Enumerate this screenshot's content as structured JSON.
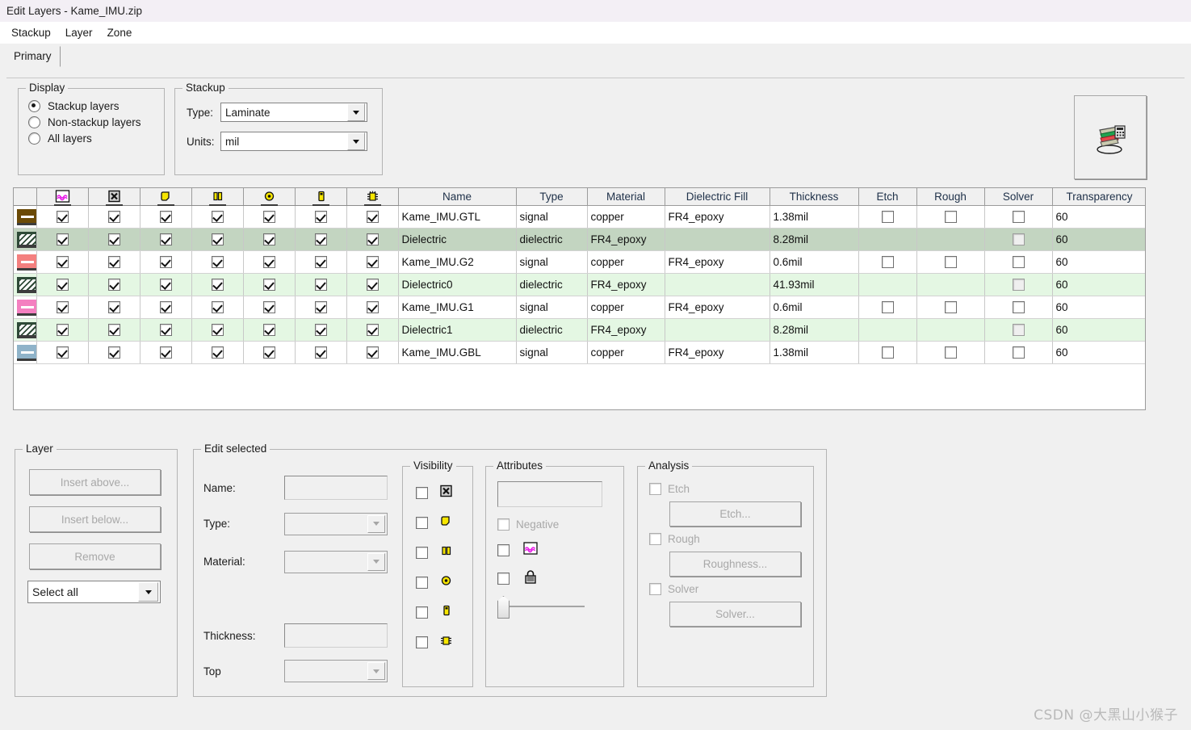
{
  "window": {
    "title": "Edit Layers - Kame_IMU.zip"
  },
  "menubar": {
    "items": [
      "Stackup",
      "Layer",
      "Zone"
    ]
  },
  "tabs": [
    {
      "label": "Primary",
      "active": true
    }
  ],
  "display": {
    "legend": "Display",
    "options": [
      {
        "label": "Stackup layers",
        "selected": true
      },
      {
        "label": "Non-stackup layers",
        "selected": false
      },
      {
        "label": "All layers",
        "selected": false
      }
    ]
  },
  "stackup_panel": {
    "legend": "Stackup",
    "type_label": "Type:",
    "type_value": "Laminate",
    "units_label": "Units:",
    "units_value": "mil"
  },
  "preview_button": {
    "icon": "stackup-3d-view-icon"
  },
  "table": {
    "icon_columns": [
      {
        "icon": "dielectric-hatch-icon"
      },
      {
        "icon": "negative-x-icon"
      },
      {
        "icon": "pad-blob-icon"
      },
      {
        "icon": "traces-bars-icon"
      },
      {
        "icon": "via-ring-icon"
      },
      {
        "icon": "drill-pin-icon"
      },
      {
        "icon": "component-icon"
      }
    ],
    "text_columns": [
      "Name",
      "Type",
      "Material",
      "Dielectric Fill",
      "Thickness",
      "Etch",
      "Rough",
      "Solver",
      "Transparency"
    ],
    "rows": [
      {
        "color": "#6b4a06",
        "kind": "signal",
        "selected": false,
        "name": "Kame_IMU.GTL",
        "type": "signal",
        "material": "copper",
        "fill": "FR4_epoxy",
        "thickness": "1.38mil",
        "etch": false,
        "rough": false,
        "solver": false,
        "transparency": "60",
        "checks": [
          true,
          true,
          true,
          true,
          true,
          true,
          true
        ]
      },
      {
        "color": "#2e4a37",
        "kind": "dielectric",
        "selected": true,
        "name": "Dielectric",
        "type": "dielectric",
        "material": "FR4_epoxy",
        "fill": "",
        "thickness": "8.28mil",
        "etch": null,
        "rough": null,
        "solver": false,
        "transparency": "60",
        "checks": [
          true,
          true,
          true,
          true,
          true,
          true,
          true
        ]
      },
      {
        "color": "#f4807f",
        "kind": "signal",
        "selected": false,
        "name": "Kame_IMU.G2",
        "type": "signal",
        "material": "copper",
        "fill": "FR4_epoxy",
        "thickness": "0.6mil",
        "etch": false,
        "rough": false,
        "solver": false,
        "transparency": "60",
        "checks": [
          true,
          true,
          true,
          true,
          true,
          true,
          true
        ]
      },
      {
        "color": "#2e4a37",
        "kind": "dielectric",
        "selected": false,
        "name": "Dielectric0",
        "type": "dielectric",
        "material": "FR4_epoxy",
        "fill": "",
        "thickness": "41.93mil",
        "etch": null,
        "rough": null,
        "solver": false,
        "transparency": "60",
        "checks": [
          true,
          true,
          true,
          true,
          true,
          true,
          true
        ]
      },
      {
        "color": "#f47fc0",
        "kind": "signal",
        "selected": false,
        "name": "Kame_IMU.G1",
        "type": "signal",
        "material": "copper",
        "fill": "FR4_epoxy",
        "thickness": "0.6mil",
        "etch": false,
        "rough": false,
        "solver": false,
        "transparency": "60",
        "checks": [
          true,
          true,
          true,
          true,
          true,
          true,
          true
        ]
      },
      {
        "color": "#2e4a37",
        "kind": "dielectric",
        "selected": false,
        "name": "Dielectric1",
        "type": "dielectric",
        "material": "FR4_epoxy",
        "fill": "",
        "thickness": "8.28mil",
        "etch": null,
        "rough": null,
        "solver": false,
        "transparency": "60",
        "checks": [
          true,
          true,
          true,
          true,
          true,
          true,
          true
        ]
      },
      {
        "color": "#8fb3c9",
        "kind": "signal",
        "selected": false,
        "name": "Kame_IMU.GBL",
        "type": "signal",
        "material": "copper",
        "fill": "FR4_epoxy",
        "thickness": "1.38mil",
        "etch": false,
        "rough": false,
        "solver": false,
        "transparency": "60",
        "checks": [
          true,
          true,
          true,
          true,
          true,
          true,
          true
        ]
      }
    ]
  },
  "layer_panel": {
    "legend": "Layer",
    "insert_above": "Insert above...",
    "insert_below": "Insert below...",
    "remove": "Remove",
    "select_value": "Select all"
  },
  "edit_selected": {
    "legend": "Edit selected",
    "name_label": "Name:",
    "name_value": "",
    "type_label": "Type:",
    "type_value": "",
    "material_label": "Material:",
    "material_value": "",
    "thickness_label": "Thickness:",
    "thickness_value": "",
    "top_label": "Top",
    "top_value": ""
  },
  "visibility": {
    "legend": "Visibility",
    "rows": [
      {
        "icon": "negative-x-icon",
        "checked": false
      },
      {
        "icon": "pad-blob-icon",
        "checked": false
      },
      {
        "icon": "traces-bars-icon",
        "checked": false
      },
      {
        "icon": "via-ring-icon",
        "checked": false
      },
      {
        "icon": "drill-pin-icon",
        "checked": false
      },
      {
        "icon": "component-icon",
        "checked": false
      }
    ]
  },
  "attributes": {
    "legend": "Attributes",
    "color_value": "",
    "negative_label": "Negative",
    "negative_checked": false,
    "hatch_icon": "dielectric-hatch-icon",
    "hatch_checked": false,
    "lock_icon": "lock-icon",
    "lock_checked": false,
    "transparency_slider": 0
  },
  "analysis": {
    "legend": "Analysis",
    "etch_check": "Etch",
    "etch_button": "Etch...",
    "rough_check": "Rough",
    "rough_button": "Roughness...",
    "solver_check": "Solver",
    "solver_button": "Solver..."
  },
  "watermark": {
    "text": "CSDN @大黑山小猴子"
  }
}
